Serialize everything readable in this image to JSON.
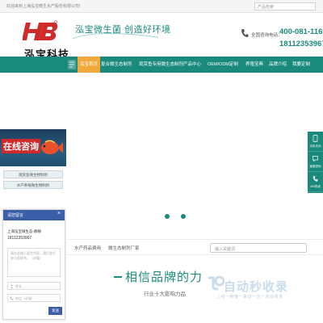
{
  "topbar": {
    "welcome": "欢迎来到上海泓宝微生水产股份有限公司!",
    "search_placeholder": "产品检索"
  },
  "header": {
    "logo_text": "泓宝科技",
    "slogan": "泓宝微生菌  创造好环境",
    "hotline_label": "全国咨询电话：",
    "hotline_1": "400-081-1169",
    "hotline_2": "18112353967"
  },
  "nav": {
    "items": [
      {
        "label": "泓宝首页",
        "active": true
      },
      {
        "label": "复合微生态制剂"
      },
      {
        "label": "观赏鱼专用微生态制剂"
      },
      {
        "label": "产品中心"
      },
      {
        "label": "OEM/ODM定制"
      },
      {
        "label": "养殖宝典"
      },
      {
        "label": "品牌介绍"
      },
      {
        "label": "我要定制"
      }
    ]
  },
  "consult": {
    "title": "在线咨询",
    "buttons": [
      "观赏鱼微生物制剂",
      "水产养殖微生物制剂"
    ]
  },
  "sidebar": {
    "items": [
      {
        "label": "手机访问",
        "icon": "mobile-icon"
      },
      {
        "label": "客服咨询",
        "icon": "chat-icon"
      },
      {
        "label": "400热线",
        "icon": "phone-icon"
      }
    ]
  },
  "chat": {
    "title": "请您留言",
    "close": "×",
    "company": "上海泓宝微生态-静静",
    "phone": "18112353967",
    "message_placeholder": "请在此输入留言内容，我们会尽快与您联系。（必填）",
    "name_placeholder": "姓名",
    "contact_placeholder": "电话（必填）",
    "send_label": "发送"
  },
  "strip": {
    "tabs": [
      "水产药品费用",
      "微生态制剂厂家"
    ],
    "search_placeholder": "输入关键词"
  },
  "brand": {
    "title": "相信品牌的力",
    "subtitle": "行业十大影响力品"
  },
  "watermark": {
    "text": "自动秒收录",
    "sub": "上线一链接一来访一次一自动收录"
  },
  "colors": {
    "primary": "#1a8a7c",
    "accent": "#f2a93b",
    "chat": "#3b5ea9",
    "logo_red": "#d12a2a"
  }
}
